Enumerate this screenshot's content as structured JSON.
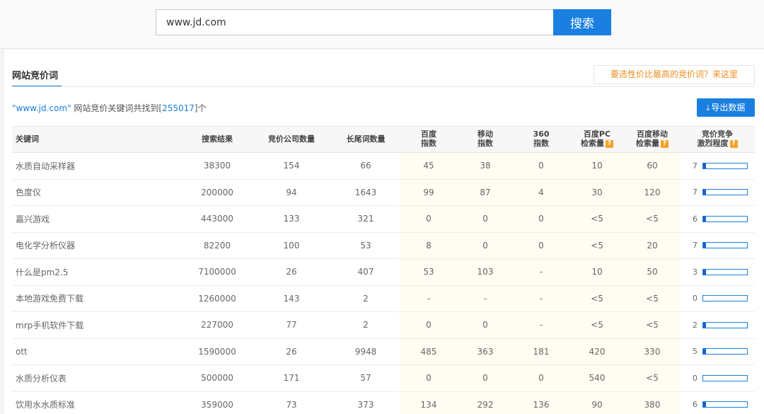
{
  "search": {
    "value": "www.jd.com",
    "button_label": "搜索"
  },
  "tab": {
    "label": "网站竞价词"
  },
  "promo": {
    "label": "要选性价比最高的竞价词？来这里"
  },
  "summary": {
    "prefix": "\"www.jd.com\"",
    "middle": " 网站竞价关键词共找到[",
    "count": "255017",
    "suffix": "]个"
  },
  "export": {
    "label": "导出数据",
    "icon": "download-icon"
  },
  "table": {
    "headers": [
      {
        "line1": "关键词",
        "line2": ""
      },
      {
        "line1": "搜索结果",
        "line2": ""
      },
      {
        "line1": "竞价公司数量",
        "line2": ""
      },
      {
        "line1": "长尾词数量",
        "line2": ""
      },
      {
        "line1": "百度",
        "line2": "指数"
      },
      {
        "line1": "移动",
        "line2": "指数"
      },
      {
        "line1": "360",
        "line2": "指数"
      },
      {
        "line1": "百度PC",
        "line2": "检索量",
        "help": "?"
      },
      {
        "line1": "百度移动",
        "line2": "检索量",
        "help": "?"
      },
      {
        "line1": "竞价竞争",
        "line2": "激烈程度",
        "help": "?"
      }
    ],
    "rows": [
      {
        "keyword": "水质自动采样器",
        "results": "38300",
        "companies": "154",
        "longtail": "66",
        "baidu": "45",
        "mobile": "38",
        "s360": "0",
        "pc": "10",
        "mob": "60",
        "comp": "7"
      },
      {
        "keyword": "色度仪",
        "results": "200000",
        "companies": "94",
        "longtail": "1643",
        "baidu": "99",
        "mobile": "87",
        "s360": "4",
        "pc": "30",
        "mob": "120",
        "comp": "7"
      },
      {
        "keyword": "嘉兴游戏",
        "results": "443000",
        "companies": "133",
        "longtail": "321",
        "baidu": "0",
        "mobile": "0",
        "s360": "0",
        "pc": "<5",
        "mob": "<5",
        "comp": "6"
      },
      {
        "keyword": "电化学分析仪器",
        "results": "82200",
        "companies": "100",
        "longtail": "53",
        "baidu": "8",
        "mobile": "0",
        "s360": "0",
        "pc": "<5",
        "mob": "20",
        "comp": "7"
      },
      {
        "keyword": "什么是pm2.5",
        "results": "7100000",
        "companies": "26",
        "longtail": "407",
        "baidu": "53",
        "mobile": "103",
        "s360": "-",
        "pc": "10",
        "mob": "50",
        "comp": "3"
      },
      {
        "keyword": "本地游戏免费下载",
        "results": "1260000",
        "companies": "143",
        "longtail": "2",
        "baidu": "-",
        "mobile": "-",
        "s360": "-",
        "pc": "<5",
        "mob": "<5",
        "comp": "0"
      },
      {
        "keyword": "mrp手机软件下载",
        "results": "227000",
        "companies": "77",
        "longtail": "2",
        "baidu": "0",
        "mobile": "0",
        "s360": "-",
        "pc": "<5",
        "mob": "<5",
        "comp": "2"
      },
      {
        "keyword": "ott",
        "results": "1590000",
        "companies": "26",
        "longtail": "9948",
        "baidu": "485",
        "mobile": "363",
        "s360": "181",
        "pc": "420",
        "mob": "330",
        "comp": "5"
      },
      {
        "keyword": "水质分析仪表",
        "results": "500000",
        "companies": "171",
        "longtail": "57",
        "baidu": "0",
        "mobile": "0",
        "s360": "0",
        "pc": "540",
        "mob": "<5",
        "comp": "0"
      },
      {
        "keyword": "饮用水水质标准",
        "results": "359000",
        "companies": "73",
        "longtail": "373",
        "baidu": "134",
        "mobile": "292",
        "s360": "136",
        "pc": "90",
        "mob": "380",
        "comp": "6"
      }
    ]
  },
  "colors": {
    "accent": "#1a7fe0",
    "promo_text": "#f08c1f",
    "help_badge": "#f3a32a"
  }
}
